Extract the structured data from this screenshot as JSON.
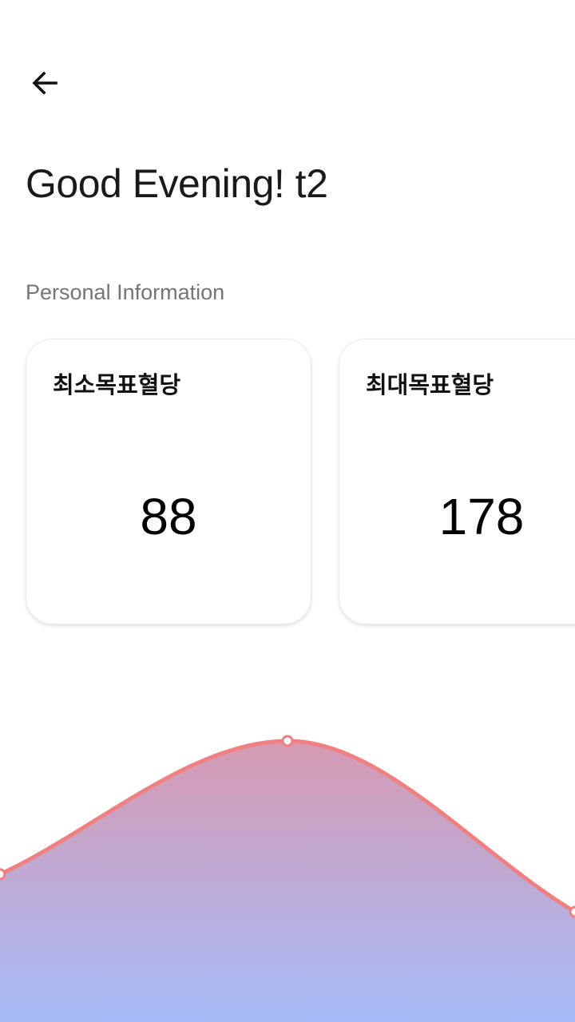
{
  "header": {
    "back_icon": "arrow-left-icon",
    "greeting": "Good Evening! t2"
  },
  "section": {
    "title": "Personal Information"
  },
  "cards": [
    {
      "label": "최소목표혈당",
      "value": "88"
    },
    {
      "label": "최대목표혈당",
      "value": "178"
    }
  ],
  "colors": {
    "line": "#f07f80",
    "fill_top": "#d69ab2",
    "fill_bottom": "#a6bcf8",
    "point_fill": "#ffffff"
  },
  "chart_data": {
    "type": "area",
    "x": [
      0,
      1,
      2
    ],
    "values": [
      0.22,
      1.0,
      0.0
    ],
    "smooth": true,
    "grid": false,
    "legend": false
  }
}
